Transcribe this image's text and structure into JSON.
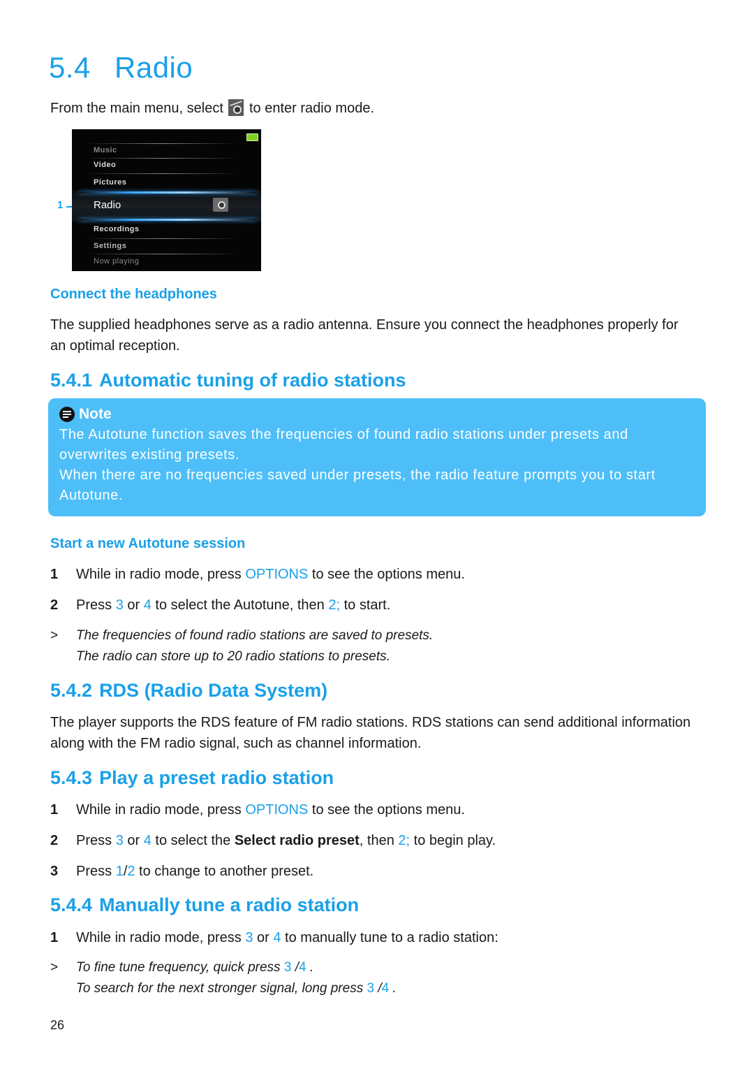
{
  "page": {
    "title": {
      "number": "5.4",
      "text": "Radio"
    },
    "intro": {
      "before": "From the main menu, select",
      "icon": "radio-icon",
      "after": "to enter radio mode."
    },
    "device_screen": {
      "callout": "1",
      "menu_items": [
        "Music",
        "Video",
        "Pictures",
        "Radio",
        "Recordings",
        "Settings",
        "Now playing"
      ],
      "selected": "Radio",
      "battery_color": "#7ed321"
    },
    "connect": {
      "heading": "Connect the headphones",
      "body": "The supplied headphones serve as a radio antenna. Ensure you connect the headphones properly for an optimal reception."
    },
    "s541": {
      "number": "5.4.1",
      "title": "Automatic tuning of radio stations",
      "note": {
        "title": "Note",
        "icon": "note-icon",
        "line1": "The Autotune function saves the frequencies of found radio stations under presets and overwrites existing presets.",
        "line2": "When there are no frequencies saved under presets, the radio feature prompts you to start Autotune."
      },
      "sub_heading": "Start a new Autotune session",
      "steps": [
        {
          "n": "1",
          "a": "While in radio mode, press ",
          "key": "OPTIONS",
          "b": " to see the options menu."
        },
        {
          "n": "2",
          "a": "Press ",
          "k1": "3",
          "mid": " or ",
          "k2": "4",
          "b": " to select the Autotune, then ",
          "k3": "2;",
          "c": " to start."
        }
      ],
      "result": {
        "marker": ">",
        "line1": "The frequencies of found radio stations are saved to presets.",
        "line2": "The radio can store up to 20 radio stations to presets."
      }
    },
    "s542": {
      "number": "5.4.2",
      "title": "RDS (Radio Data System)",
      "body": "The player supports the RDS feature of FM radio stations. RDS stations can send additional information along with the FM radio signal, such as channel information."
    },
    "s543": {
      "number": "5.4.3",
      "title": "Play a preset radio station",
      "steps": [
        {
          "n": "1",
          "a": "While in radio mode, press ",
          "key": "OPTIONS",
          "b": " to see the options menu."
        },
        {
          "n": "2",
          "a": "Press ",
          "k1": "3",
          "mid": " or ",
          "k2": "4",
          "b": " to select the ",
          "bold": "Select radio preset",
          "c": ", then ",
          "k3": "2;",
          "d": " to begin play."
        },
        {
          "n": "3",
          "a": "Press ",
          "k1": "1",
          "sep": "/",
          "k2": "2",
          "b": " to change to another preset."
        }
      ]
    },
    "s544": {
      "number": "5.4.4",
      "title": "Manually tune a radio station",
      "step": {
        "n": "1",
        "a": "While in radio mode, press ",
        "k1": "3",
        "mid": " or ",
        "k2": "4",
        "b": " to manually tune to a radio station:"
      },
      "result": {
        "marker": ">",
        "line1a": "To fine tune frequency, quick press ",
        "line1k1": "3",
        "line1sep": " /",
        "line1k2": "4",
        "line1end": " .",
        "line2a": "To search for the next stronger signal, long press ",
        "line2k1": "3",
        "line2sep": " /",
        "line2k2": "4",
        "line2end": " ."
      }
    },
    "page_number": "26",
    "accent_color": "#1aa0e8",
    "note_color": "#4dbef8"
  }
}
